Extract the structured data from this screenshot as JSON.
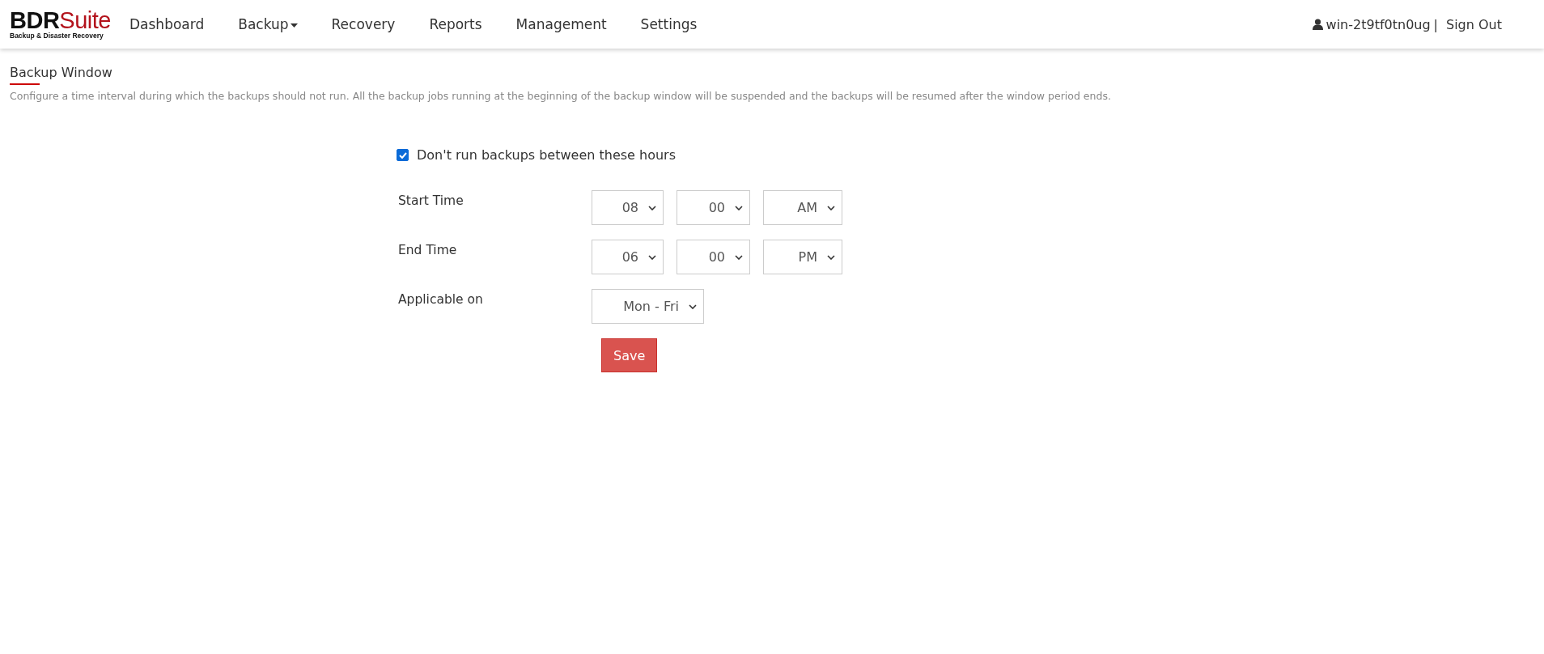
{
  "logo": {
    "wordmark_dark": "BDR",
    "wordmark_accent": "Suite",
    "tagline": "Backup & Disaster Recovery"
  },
  "nav": [
    {
      "label": "Dashboard",
      "has_menu": false
    },
    {
      "label": "Backup",
      "has_menu": true
    },
    {
      "label": "Recovery",
      "has_menu": false
    },
    {
      "label": "Reports",
      "has_menu": false
    },
    {
      "label": "Management",
      "has_menu": false
    },
    {
      "label": "Settings",
      "has_menu": false
    }
  ],
  "user": {
    "name": "win-2t9tf0tn0ug",
    "separator": "|",
    "sign_out": "Sign Out"
  },
  "page": {
    "title": "Backup Window",
    "description": "Configure a time interval during which the backups should not run. All the backup jobs running at the beginning of the backup window will be suspended and the backups will be resumed after the window period ends."
  },
  "form": {
    "enable": {
      "label": "Don't run backups between these hours",
      "checked": true
    },
    "rows": [
      {
        "label": "Start Time",
        "selects": [
          "08",
          "00",
          "AM"
        ]
      },
      {
        "label": "End Time",
        "selects": [
          "06",
          "00",
          "PM"
        ]
      },
      {
        "label": "Applicable on",
        "selects": [
          "Mon - Fri"
        ]
      }
    ],
    "save": "Save"
  }
}
